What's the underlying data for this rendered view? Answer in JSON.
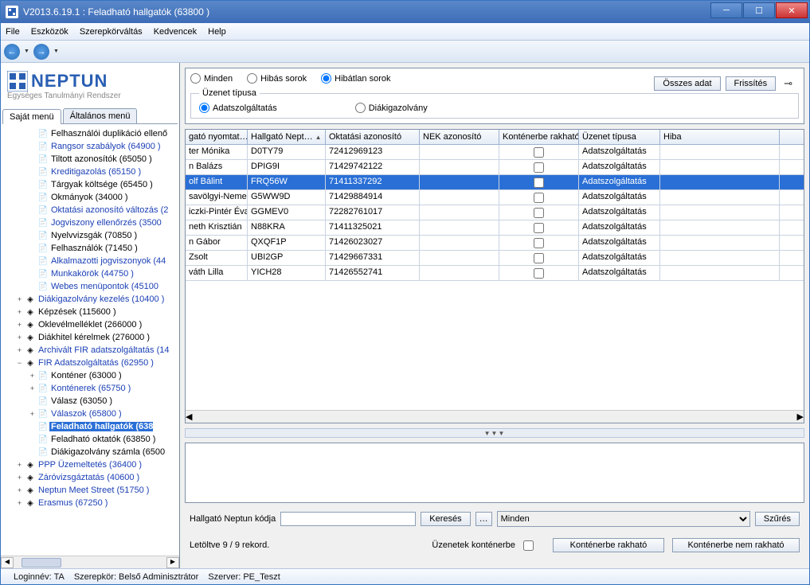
{
  "window": {
    "title": "V2013.6.19.1 : Feladható hallgatók (63800  )"
  },
  "menu": {
    "file": "File",
    "tools": "Eszközök",
    "roles": "Szerepkörváltás",
    "fav": "Kedvencek",
    "help": "Help"
  },
  "logo": {
    "text": "NEPTUN",
    "sub": "Egységes Tanulmányi Rendszer"
  },
  "tabs": {
    "own": "Saját menü",
    "gen": "Általános menü"
  },
  "tree": {
    "items": [
      {
        "indent": 2,
        "exp": "",
        "icon": "📄",
        "label": "Felhasználói duplikáció ellenő"
      },
      {
        "indent": 2,
        "exp": "",
        "icon": "📄",
        "label": "Rangsor szabályok (64900  )",
        "link": true
      },
      {
        "indent": 2,
        "exp": "",
        "icon": "📄",
        "label": "Tiltott azonosítók (65050  )"
      },
      {
        "indent": 2,
        "exp": "",
        "icon": "📄",
        "label": "Kreditigazolás (65150  )",
        "link": true
      },
      {
        "indent": 2,
        "exp": "",
        "icon": "📄",
        "label": "Tárgyak költsége (65450  )"
      },
      {
        "indent": 2,
        "exp": "",
        "icon": "📄",
        "label": "Okmányok (34000  )"
      },
      {
        "indent": 2,
        "exp": "",
        "icon": "📄",
        "label": "Oktatási azonosító változás (2",
        "link": true
      },
      {
        "indent": 2,
        "exp": "",
        "icon": "📄",
        "label": "Jogviszony ellenőrzés (3500  ",
        "link": true
      },
      {
        "indent": 2,
        "exp": "",
        "icon": "📄",
        "label": "Nyelvvizsgák (70850  )"
      },
      {
        "indent": 2,
        "exp": "",
        "icon": "📄",
        "label": "Felhasználók (71450  )"
      },
      {
        "indent": 2,
        "exp": "",
        "icon": "📄",
        "label": "Alkalmazotti jogviszonyok (44",
        "link": true
      },
      {
        "indent": 2,
        "exp": "",
        "icon": "📄",
        "label": "Munkakörök (44750  )",
        "link": true
      },
      {
        "indent": 2,
        "exp": "",
        "icon": "📄",
        "label": "Webes menüpontok (45100  ",
        "link": true
      },
      {
        "indent": 1,
        "exp": "+",
        "icon": "◈",
        "label": "Diákigazolvány kezelés (10400  )",
        "link": true
      },
      {
        "indent": 1,
        "exp": "+",
        "icon": "◈",
        "label": "Képzések (115600  )"
      },
      {
        "indent": 1,
        "exp": "+",
        "icon": "◈",
        "label": "Oklevélmelléklet (266000  )"
      },
      {
        "indent": 1,
        "exp": "+",
        "icon": "◈",
        "label": "Diákhitel kérelmek (276000  )"
      },
      {
        "indent": 1,
        "exp": "+",
        "icon": "◈",
        "label": "Archivált FIR adatszolgáltatás (14",
        "link": true
      },
      {
        "indent": 1,
        "exp": "−",
        "icon": "◈",
        "label": "FIR Adatszolgáltatás (62950  )",
        "link": true
      },
      {
        "indent": 2,
        "exp": "+",
        "icon": "📄",
        "label": "Konténer (63000  )"
      },
      {
        "indent": 2,
        "exp": "+",
        "icon": "📄",
        "label": "Konténerek (65750  )",
        "link": true
      },
      {
        "indent": 2,
        "exp": "",
        "icon": "📄",
        "label": "Válasz (63050  )"
      },
      {
        "indent": 2,
        "exp": "+",
        "icon": "📄",
        "label": "Válaszok (65800  )",
        "link": true
      },
      {
        "indent": 2,
        "exp": "",
        "icon": "📄",
        "label": "Feladható hallgatók (638",
        "sel": true
      },
      {
        "indent": 2,
        "exp": "",
        "icon": "📄",
        "label": "Feladható oktatók (63850  )"
      },
      {
        "indent": 2,
        "exp": "",
        "icon": "📄",
        "label": "Diákigazolvány számla (6500"
      },
      {
        "indent": 1,
        "exp": "+",
        "icon": "◈",
        "label": "PPP Üzemeltetés (36400  )",
        "link": true
      },
      {
        "indent": 1,
        "exp": "+",
        "icon": "◈",
        "label": "Záróvizsgáztatás (40600  )",
        "link": true
      },
      {
        "indent": 1,
        "exp": "+",
        "icon": "◈",
        "label": "Neptun Meet Street (51750  )",
        "link": true
      },
      {
        "indent": 1,
        "exp": "+",
        "icon": "◈",
        "label": "Erasmus (67250  )",
        "link": true
      }
    ]
  },
  "filters": {
    "all": "Minden",
    "bad": "Hibás sorok",
    "good": "Hibátlan sorok",
    "msgType": "Üzenet típusa",
    "data": "Adatszolgáltatás",
    "card": "Diákigazolvány"
  },
  "buttons": {
    "alldata": "Összes adat",
    "refresh": "Frissítés",
    "search": "Keresés",
    "filter": "Szűrés",
    "toCont": "Konténerbe rakható",
    "notToCont": "Konténerbe nem rakható"
  },
  "grid": {
    "headers": [
      "gató nyomtat…",
      "Hallgató Nept…",
      "Oktatási azonosító",
      "NEK azonosító",
      "Konténerbe rakható",
      "Üzenet típusa",
      "Hiba"
    ],
    "rows": [
      {
        "c": [
          "ter Mónika",
          "D0TY79",
          "72412969123",
          "",
          false,
          "Adatszolgáltatás",
          ""
        ]
      },
      {
        "c": [
          "n Balázs",
          "DPIG9I",
          "71429742122",
          "",
          false,
          "Adatszolgáltatás",
          ""
        ]
      },
      {
        "c": [
          "olf Bálint",
          "FRQ56W",
          "71411337292",
          "",
          false,
          "Adatszolgáltatás",
          ""
        ],
        "sel": true
      },
      {
        "c": [
          "savölgyi-Nemes",
          "G5WW9D",
          "71429884914",
          "",
          false,
          "Adatszolgáltatás",
          ""
        ]
      },
      {
        "c": [
          "iczki-Pintér Éva",
          "GGMEV0",
          "72282761017",
          "",
          false,
          "Adatszolgáltatás",
          ""
        ]
      },
      {
        "c": [
          "neth Krisztián",
          "N88KRA",
          "71411325021",
          "",
          false,
          "Adatszolgáltatás",
          ""
        ]
      },
      {
        "c": [
          "n Gábor",
          "QXQF1P",
          "71426023027",
          "",
          false,
          "Adatszolgáltatás",
          ""
        ]
      },
      {
        "c": [
          "Zsolt",
          "UBI2GP",
          "71429667331",
          "",
          false,
          "Adatszolgáltatás",
          ""
        ]
      },
      {
        "c": [
          "váth Lilla",
          "YICH28",
          "71426552741",
          "",
          false,
          "Adatszolgáltatás",
          ""
        ]
      }
    ]
  },
  "search": {
    "label": "Hallgató Neptun kódja",
    "placeholder": "",
    "dropdown": "Minden"
  },
  "bottom": {
    "loaded": "Letöltve 9 / 9 rekord.",
    "msgToCont": "Üzenetek konténerbe"
  },
  "status": {
    "login": "Loginnév: TA",
    "role": "Szerepkör: Belső Adminisztrátor",
    "server": "Szerver: PE_Teszt"
  }
}
